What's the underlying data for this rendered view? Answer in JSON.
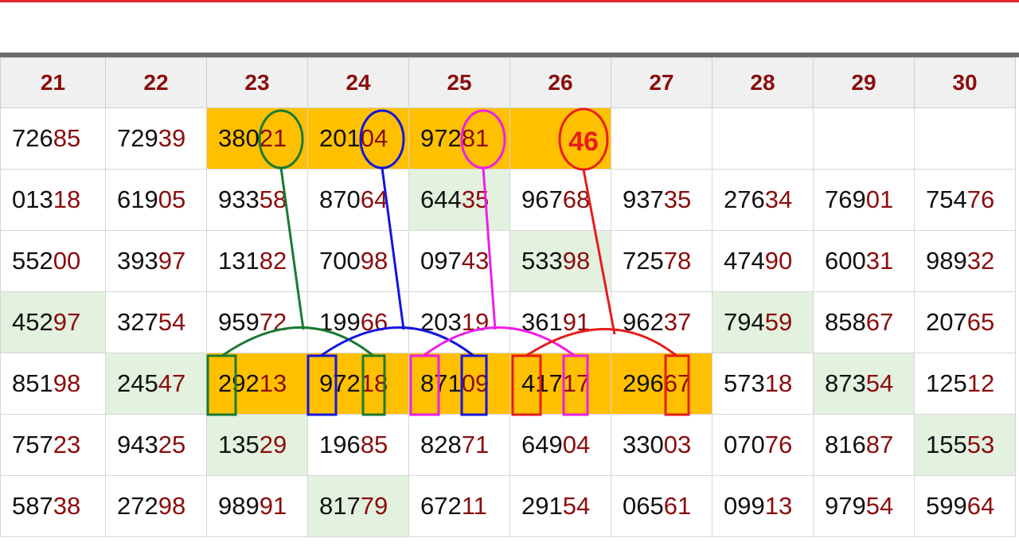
{
  "columns": [
    "21",
    "22",
    "23",
    "24",
    "25",
    "26",
    "27",
    "28",
    "29",
    "30"
  ],
  "rows": [
    [
      "72685",
      "72939",
      "38021",
      "20104",
      "97281",
      "",
      "",
      "",
      "",
      ""
    ],
    [
      "01318",
      "61905",
      "93358",
      "87064",
      "64435",
      "96768",
      "93735",
      "27634",
      "76901",
      "75476"
    ],
    [
      "55200",
      "39397",
      "13182",
      "70098",
      "09743",
      "53398",
      "72578",
      "47490",
      "60031",
      "98932"
    ],
    [
      "45297",
      "32754",
      "95972",
      "19966",
      "20319",
      "36191",
      "96237",
      "79459",
      "85867",
      "20765"
    ],
    [
      "85198",
      "24547",
      "29213",
      "97218",
      "87109",
      "41717",
      "29667",
      "57318",
      "87354",
      "12512"
    ],
    [
      "75723",
      "94325",
      "13529",
      "19685",
      "82871",
      "64904",
      "33003",
      "07076",
      "81687",
      "15553"
    ],
    [
      "58738",
      "27298",
      "98991",
      "81779",
      "67211",
      "29154",
      "06561",
      "09913",
      "97954",
      "59964"
    ]
  ],
  "annotation": {
    "label": "46"
  },
  "colors": {
    "header_text": "#8b0d0d",
    "tail_digits": "#8b0d0d",
    "highlight_orange": "#ffc000",
    "highlight_green": "#e3f1df",
    "top_bar": "#e0282e",
    "connector_green": "#1b7a32",
    "connector_blue": "#1515e0",
    "connector_magenta": "#ee1ee8",
    "connector_red": "#e81c1c"
  }
}
